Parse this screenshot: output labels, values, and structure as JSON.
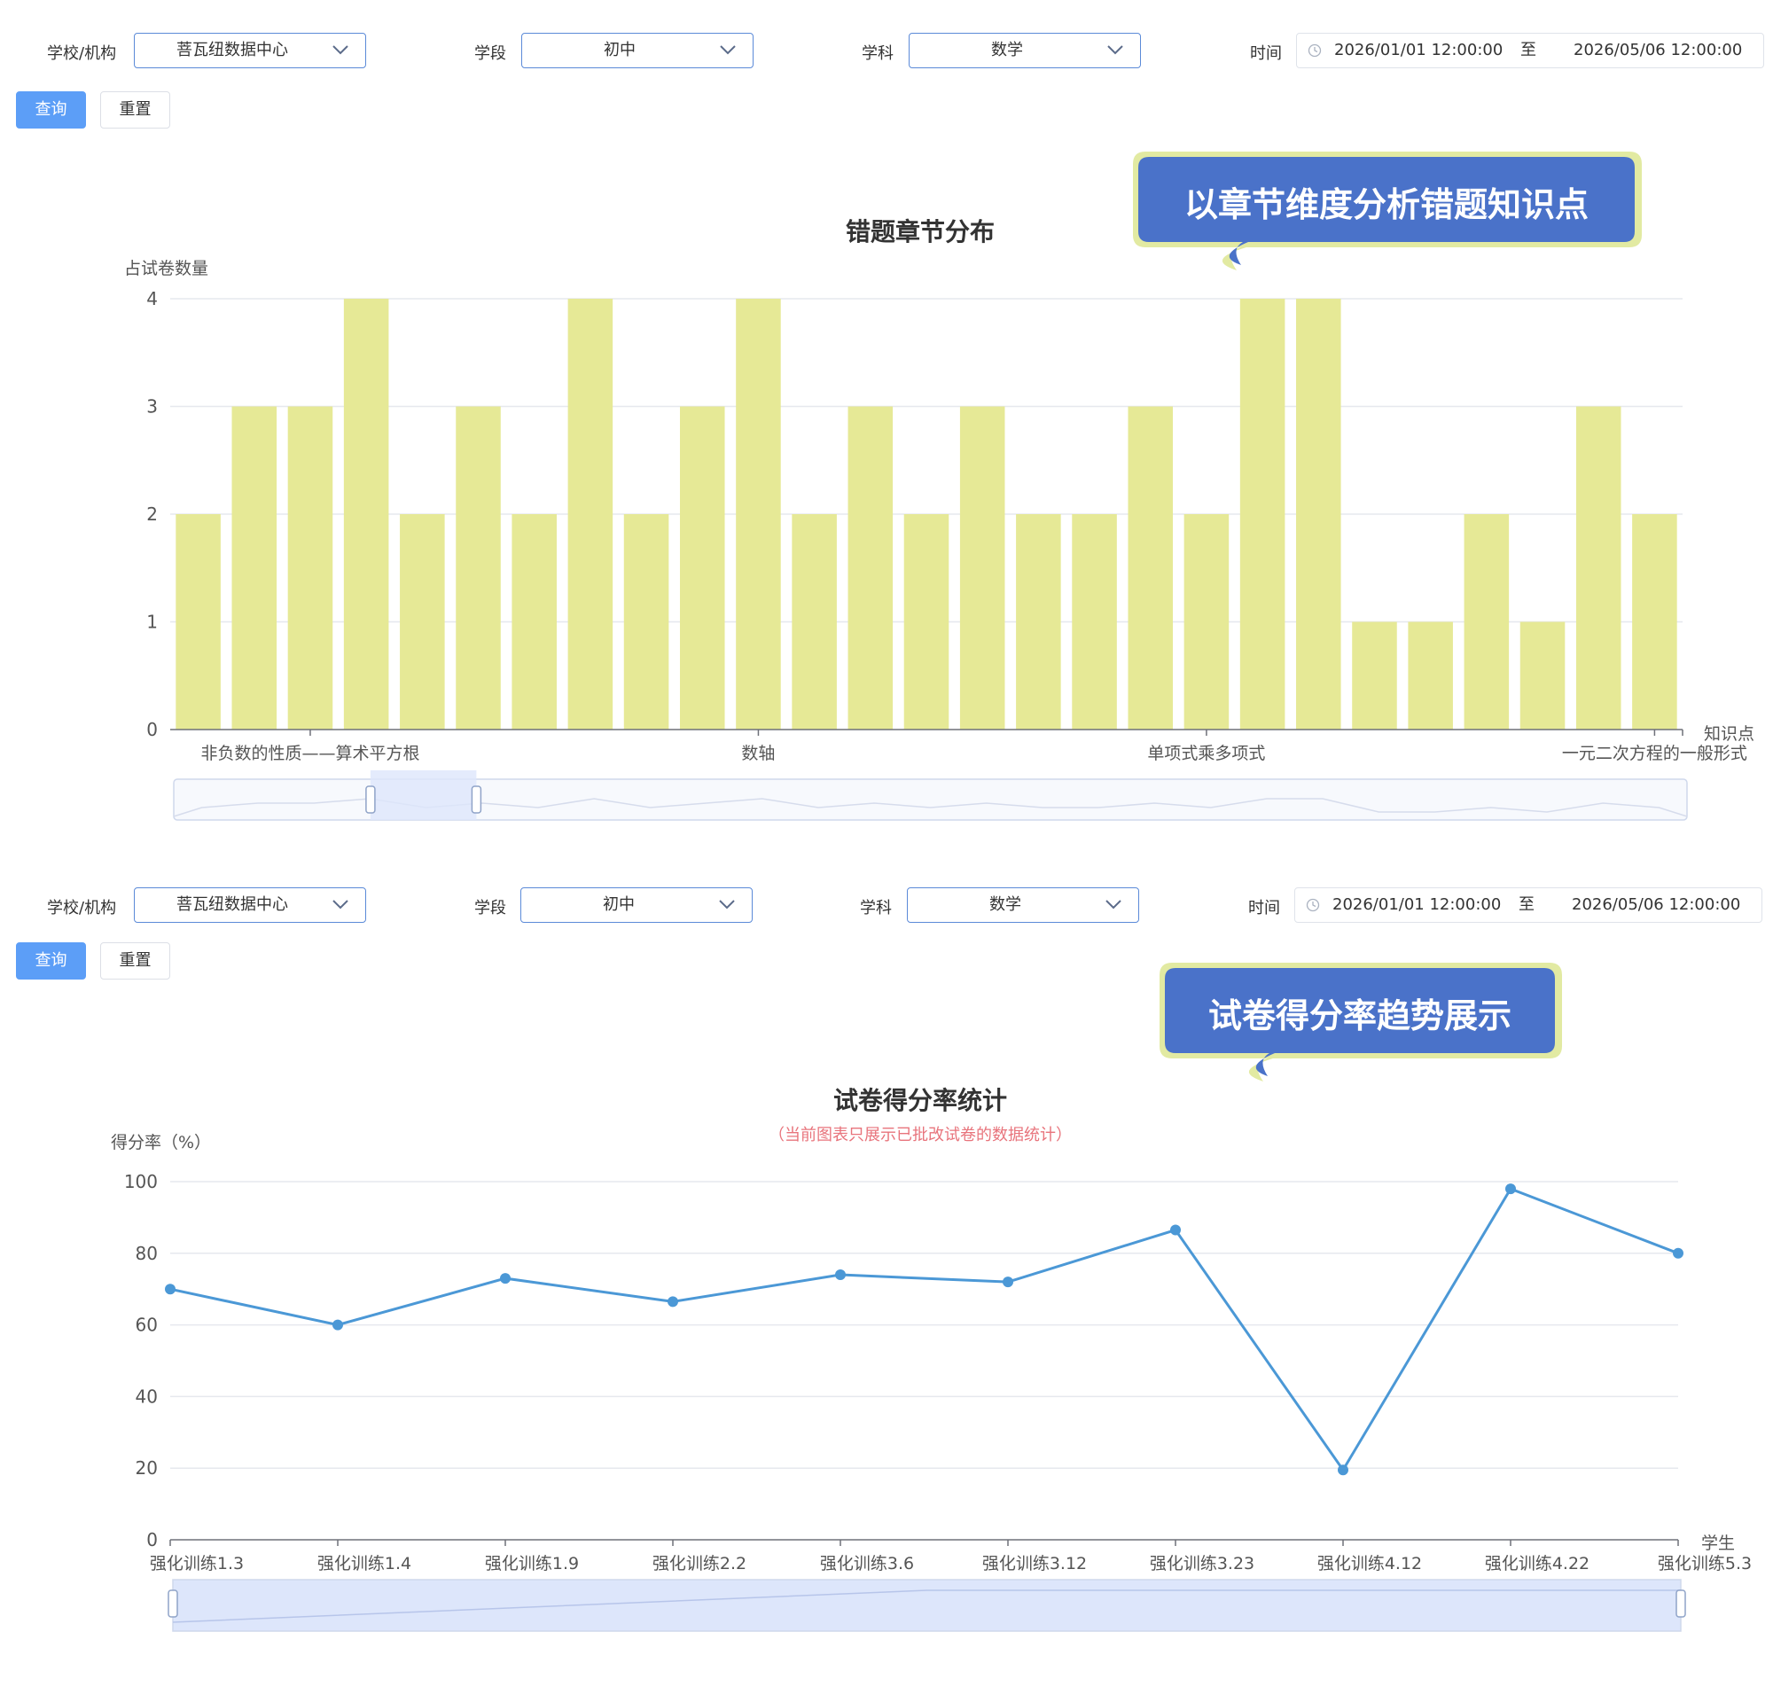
{
  "filters": {
    "school_label": "学校/机构",
    "school_value": "菩瓦纽数据中心",
    "stage_label": "学段",
    "stage_value": "初中",
    "subject_label": "学科",
    "subject_value": "数学",
    "time_label": "时间",
    "start_time": "2026/01/01 12:00:00",
    "range_sep": "至",
    "end_time": "2026/05/06 12:00:00",
    "query_label": "查询",
    "reset_label": "重置"
  },
  "callouts": {
    "top": "以章节维度分析错题知识点",
    "bottom": "试卷得分率趋势展示"
  },
  "colors": {
    "bar": "#e6e996",
    "line": "#4b98d6",
    "callout_fill": "#4a72c9",
    "callout_border": "#e2eaa2",
    "primary_button": "#5c9ef7",
    "zoom_fill": "#dde6fb",
    "subtitle": "#e8747c"
  },
  "chart_data": [
    {
      "type": "bar",
      "title": "错题章节分布",
      "ylabel": "占试卷数量",
      "xlabel": "知识点",
      "ylim": [
        0,
        4
      ],
      "yticks": [
        0,
        1,
        2,
        3,
        4
      ],
      "grid": true,
      "tick_labels": [
        {
          "index": 2,
          "label": "非负数的性质——算术平方根"
        },
        {
          "index": 10,
          "label": "数轴"
        },
        {
          "index": 18,
          "label": "单项式乘多项式"
        },
        {
          "index": 26,
          "label": "一元二次方程的一般形式"
        }
      ],
      "values": [
        2,
        3,
        3,
        4,
        2,
        3,
        2,
        4,
        2,
        3,
        4,
        2,
        3,
        2,
        3,
        2,
        2,
        3,
        2,
        4,
        4,
        1,
        1,
        2,
        1,
        3,
        2
      ],
      "zoom": {
        "start": 0.13,
        "end": 0.2
      }
    },
    {
      "type": "line",
      "title": "试卷得分率统计",
      "subtitle": "（当前图表只展示已批改试卷的数据统计）",
      "ylabel": "得分率（%）",
      "xlabel": "学生",
      "ylim": [
        0,
        100
      ],
      "yticks": [
        0,
        20,
        40,
        60,
        80,
        100
      ],
      "grid": true,
      "categories": [
        "强化训练1.3",
        "强化训练1.4",
        "强化训练1.9",
        "强化训练2.2",
        "强化训练3.6",
        "强化训练3.12",
        "强化训练3.23",
        "强化训练4.12",
        "强化训练4.22",
        "强化训练5.3"
      ],
      "values": [
        70,
        60,
        73,
        66.5,
        74,
        72,
        86.5,
        19.5,
        98,
        80
      ],
      "zoom": {
        "start": 0,
        "end": 1
      }
    }
  ]
}
